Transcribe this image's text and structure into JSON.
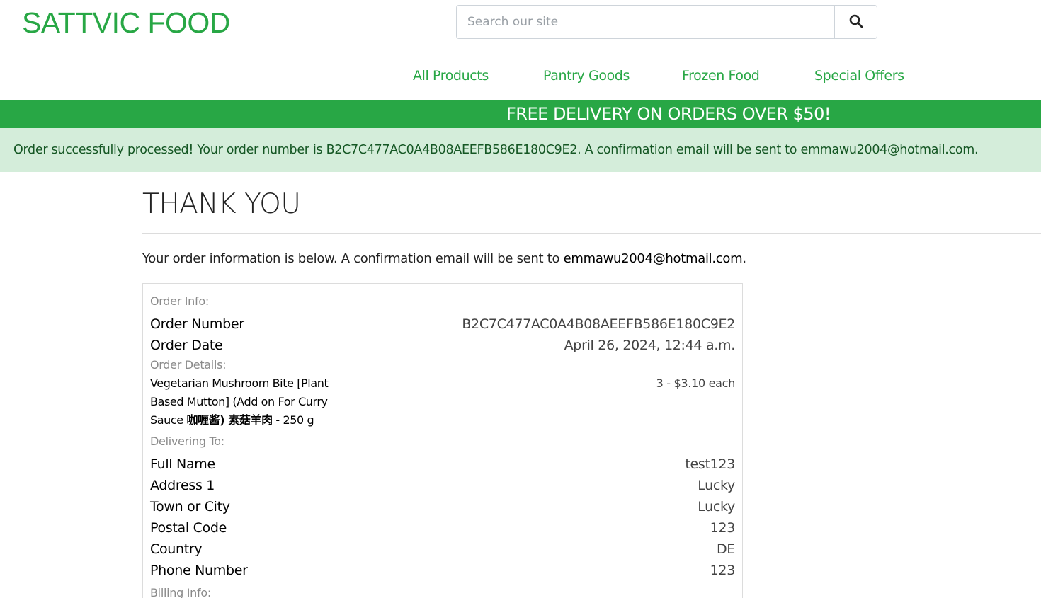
{
  "header": {
    "brand": "SATTVIC FOOD",
    "search_placeholder": "Search our site",
    "search_icon": "search-icon"
  },
  "nav": {
    "items": [
      {
        "label": "All Products"
      },
      {
        "label": "Pantry Goods"
      },
      {
        "label": "Frozen Food"
      },
      {
        "label": "Special Offers"
      }
    ]
  },
  "banner": {
    "text": "FREE DELIVERY ON ORDERS OVER $50!"
  },
  "alert": {
    "message": "Order successfully processed! Your order number is B2C7C477AC0A4B08AEEFB586E180C9E2. A confirmation email will be sent to emmawu2004@hotmail.com."
  },
  "page": {
    "title": "THANK YOU",
    "intro_prefix": "Your order information is below. A confirmation email will be sent to ",
    "intro_email": "emmawu2004@hotmail.com",
    "intro_suffix": "."
  },
  "order": {
    "order_info_label": "Order Info:",
    "order_number_label": "Order Number",
    "order_number": "B2C7C477AC0A4B08AEEFB586E180C9E2",
    "order_date_label": "Order Date",
    "order_date": "April 26, 2024, 12:44 a.m.",
    "order_details_label": "Order Details:",
    "item_name_plain": "Vegetarian Mushroom Bite [Plant Based Mutton] (Add on For Curry Sauce ",
    "item_name_bold": "咖喱酱) 素菇羊肉",
    "item_name_tail": " - 250 g",
    "item_qty": "3 - $3.10 each",
    "delivering_label": "Delivering To:",
    "full_name_label": "Full Name",
    "full_name": "test123",
    "address1_label": "Address 1",
    "address1": "Lucky",
    "town_label": "Town or City",
    "town": "Lucky",
    "postal_label": "Postal Code",
    "postal": "123",
    "country_label": "Country",
    "country": "DE",
    "phone_label": "Phone Number",
    "phone": "123",
    "billing_label": "Billing Info:"
  },
  "colors": {
    "brand_green": "#28a745",
    "alert_bg": "#d4edda",
    "alert_text": "#155724"
  }
}
